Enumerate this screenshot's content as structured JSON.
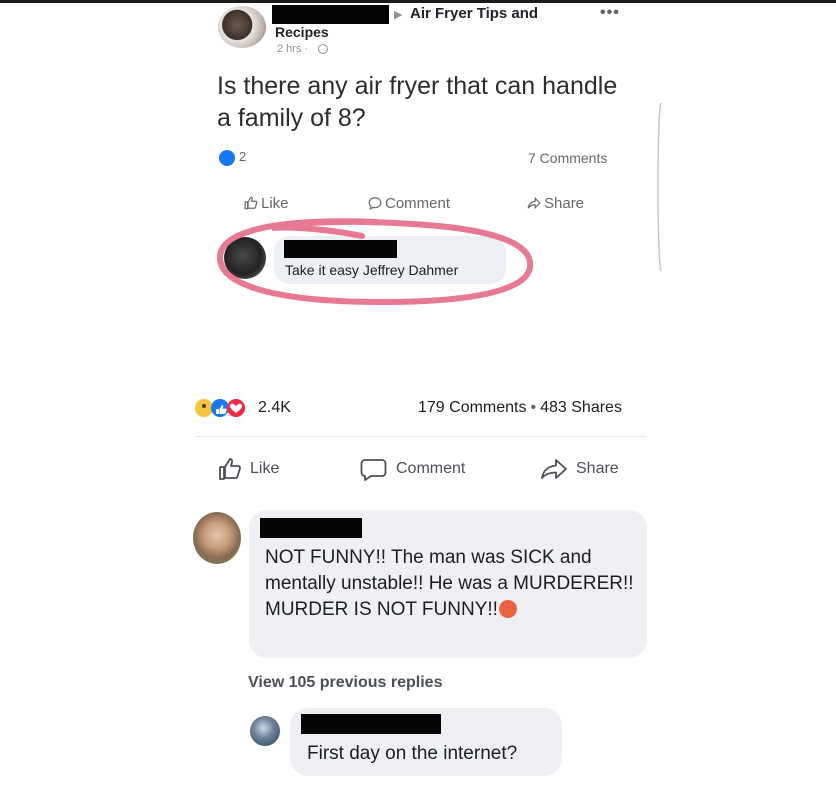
{
  "original_post": {
    "group": {
      "name_line1": "Air Fryer Tips and",
      "name_line2": "Recipes",
      "time": "2 hrs ·"
    },
    "more_icon": "more-dots-icon",
    "question": "Is there any air fryer that can handle a family of 8?",
    "reaction_count": "2",
    "comments_count": "7 Comments",
    "actions": {
      "like": "Like",
      "comment": "Comment",
      "share": "Share"
    },
    "reply": {
      "text": "Take it easy Jeffrey Dahmer"
    },
    "highlight_color": "#e46b86"
  },
  "outer_post": {
    "reaction_count": "2.4K",
    "comments": "179 Comments",
    "separator": "•",
    "shares": "483 Shares",
    "actions": {
      "like": "Like",
      "comment": "Comment",
      "share": "Share"
    }
  },
  "comments": [
    {
      "text": "NOT FUNNY!! The man was SICK and mentally unstable!! He was a MURDERER!! MURDER IS NOT FUNNY!!",
      "emoji": "angry-face-icon"
    },
    {
      "text": "First day on the internet?"
    }
  ],
  "view_replies": "View 105 previous replies",
  "colors": {
    "facebook_blue": "#1877f2",
    "bubble": "#eef0f4",
    "muted_text": "#65676b"
  }
}
